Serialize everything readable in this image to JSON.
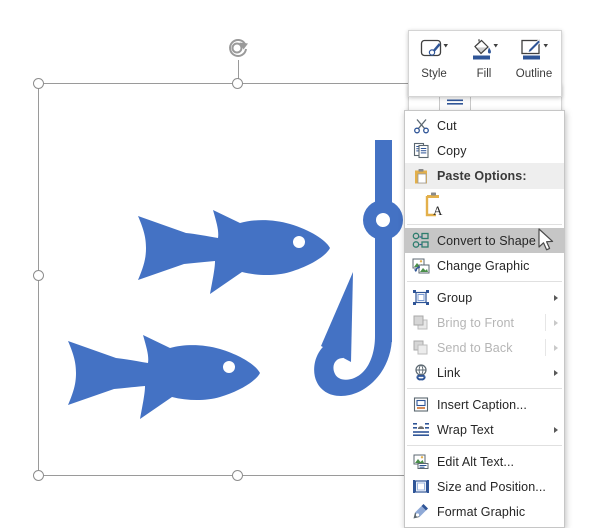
{
  "app": {
    "accent_color": "#4472C4",
    "menu_bg": "#ffffff",
    "highlight_color": "#c6c6c6",
    "header_bg": "#eeeeee"
  },
  "canvas": {
    "graphics": [
      {
        "name": "fish-top",
        "label": "Fish graphic",
        "color": "#4472C4"
      },
      {
        "name": "fish-bottom",
        "label": "Fish graphic",
        "color": "#4472C4"
      },
      {
        "name": "fishing-hook",
        "label": "Fishing hook graphic",
        "color": "#4472C4"
      }
    ],
    "selection": {
      "rotation_handle": "rotate-icon",
      "handle_count": 8
    }
  },
  "mini_toolbar": {
    "buttons": [
      {
        "label": "Style",
        "icon": "shape-style-icon"
      },
      {
        "label": "Fill",
        "icon": "fill-bucket-icon"
      },
      {
        "label": "Outline",
        "icon": "outline-pencil-icon"
      }
    ],
    "row2": [
      {
        "label": "",
        "icon": "wrap-text-icon"
      }
    ]
  },
  "context_menu": {
    "items": [
      {
        "label": "Cut",
        "accel": "t",
        "icon": "scissors-icon",
        "state": "normal",
        "submenu": false
      },
      {
        "label": "Copy",
        "accel": "C",
        "icon": "copy-icon",
        "state": "normal",
        "submenu": false
      },
      {
        "label": "Paste Options:",
        "accel": "",
        "icon": "clipboard-icon",
        "state": "header",
        "submenu": false
      },
      {
        "label": "Convert to Shape",
        "accel": "C",
        "icon": "convert-to-shape-icon",
        "state": "selected",
        "submenu": false
      },
      {
        "label": "Change Graphic",
        "accel": "h",
        "icon": "change-graphic-icon",
        "state": "normal",
        "submenu": false
      },
      {
        "label": "Group",
        "accel": "G",
        "icon": "group-icon",
        "state": "normal",
        "submenu": true
      },
      {
        "label": "Bring to Front",
        "accel": "r",
        "icon": "bring-to-front-icon",
        "state": "disabled",
        "submenu": true
      },
      {
        "label": "Send to Back",
        "accel": "k",
        "icon": "send-to-back-icon",
        "state": "disabled",
        "submenu": true
      },
      {
        "label": "Link",
        "accel": "n",
        "icon": "link-icon",
        "state": "normal",
        "submenu": true
      },
      {
        "label": "Insert Caption...",
        "accel": "n",
        "icon": "insert-caption-icon",
        "state": "normal",
        "submenu": false
      },
      {
        "label": "Wrap Text",
        "accel": "W",
        "icon": "wrap-text-icon",
        "state": "normal",
        "submenu": true
      },
      {
        "label": "Edit Alt Text...",
        "accel": "A",
        "icon": "edit-alt-text-icon",
        "state": "normal",
        "submenu": false
      },
      {
        "label": "Size and Position...",
        "accel": "z",
        "icon": "size-and-position-icon",
        "state": "normal",
        "submenu": false
      },
      {
        "label": "Format Graphic",
        "accel": "",
        "icon": "format-graphic-icon",
        "state": "normal",
        "submenu": false
      }
    ],
    "paste_option": {
      "label": "",
      "icon": "paste-keep-text-only-icon"
    }
  }
}
